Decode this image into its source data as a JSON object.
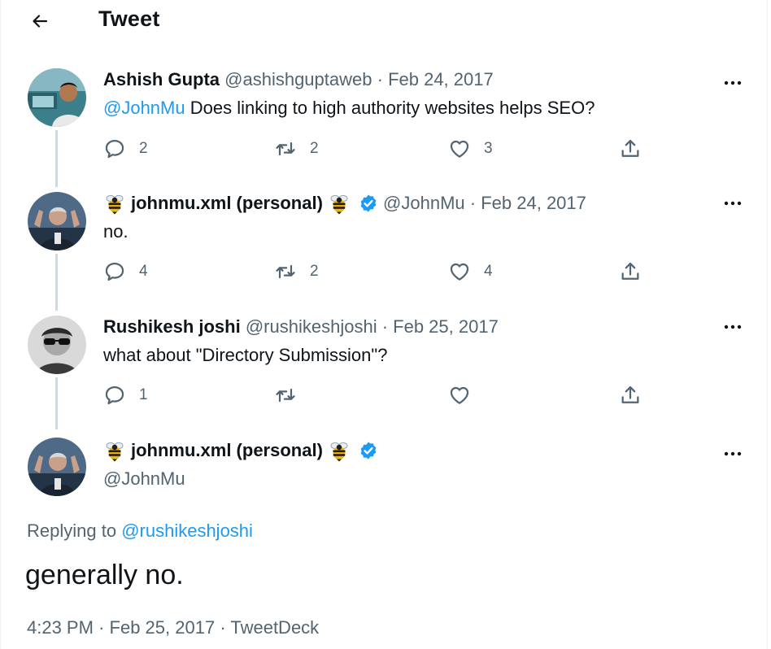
{
  "header": {
    "title": "Tweet"
  },
  "tweets": [
    {
      "name": "Ashish Gupta",
      "handle": "@ashishguptaweb",
      "sep": "·",
      "date": "Feb 24, 2017",
      "mention": "@JohnMu",
      "text": " Does linking to high authority websites helps SEO?",
      "replies": "2",
      "retweets": "2",
      "likes": "3"
    },
    {
      "name": "johnmu.xml (personal)",
      "handle": "@JohnMu",
      "sep": "·",
      "date": "Feb 24, 2017",
      "text": "no.",
      "replies": "4",
      "retweets": "2",
      "likes": "4"
    },
    {
      "name": "Rushikesh joshi",
      "handle": "@rushikeshjoshi",
      "sep": "·",
      "date": "Feb 25, 2017",
      "text": "what about \"Directory Submission\"?",
      "replies": "1",
      "retweets": "",
      "likes": ""
    }
  ],
  "main": {
    "name": "johnmu.xml (personal)",
    "handle": "@JohnMu",
    "replying_prefix": "Replying to ",
    "replying_to": "@rushikeshjoshi",
    "text": "generally no.",
    "time": "4:23 PM",
    "sep": "·",
    "date": "Feb 25, 2017",
    "sep2": "·",
    "source": "TweetDeck"
  },
  "icons": {
    "back": "arrow-left-icon",
    "reply": "reply-icon",
    "retweet": "retweet-icon",
    "like": "heart-icon",
    "share": "share-icon",
    "more": "more-icon",
    "verified": "verified-badge-icon",
    "bee": "bee-emoji-icon"
  },
  "colors": {
    "accent": "#1d9bf0",
    "text": "#0f1419",
    "secondary": "#536471",
    "thread_line": "#cfd9de"
  }
}
